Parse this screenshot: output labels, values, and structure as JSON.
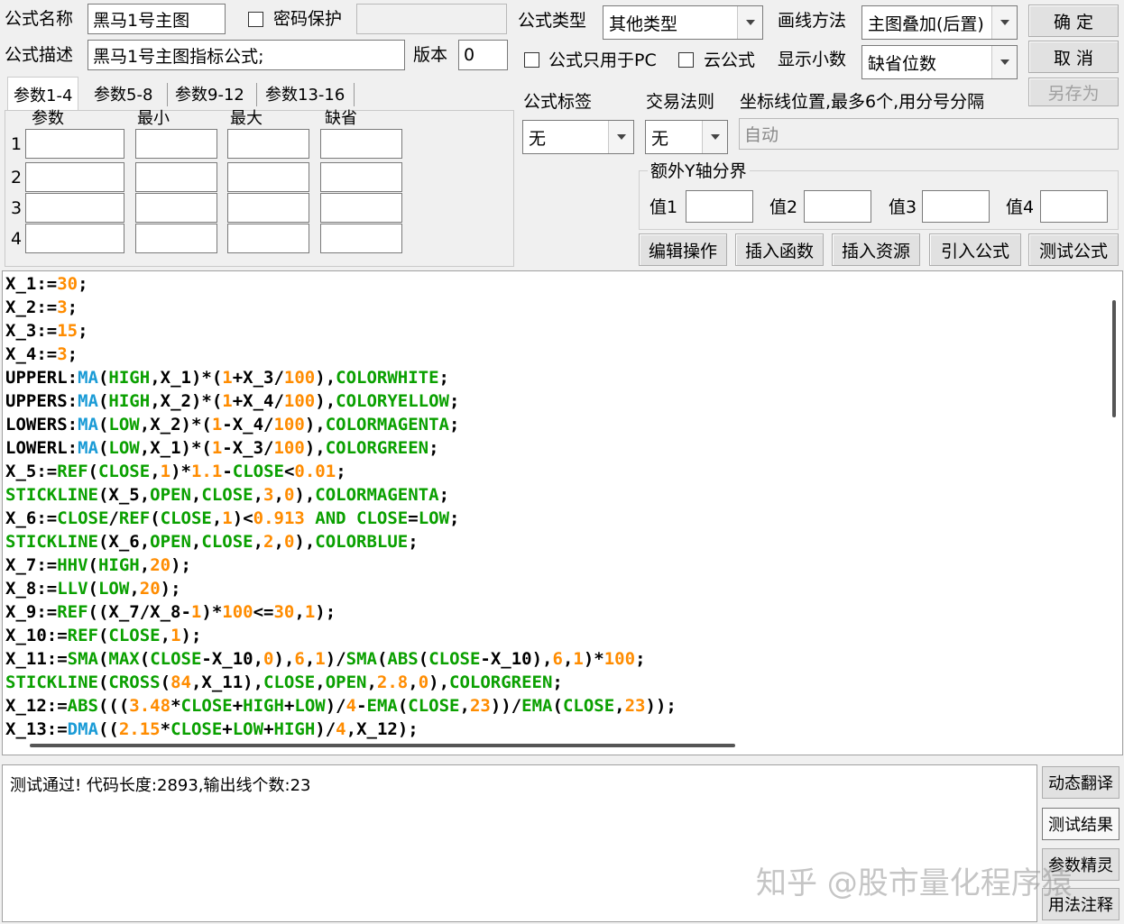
{
  "header": {
    "name_label": "公式名称",
    "name_value": "黑马1号主图",
    "password_label": "密码保护",
    "desc_label": "公式描述",
    "desc_value": "黑马1号主图指标公式;",
    "version_label": "版本",
    "version_value": "0",
    "type_label": "公式类型",
    "type_value": "其他类型",
    "draw_label": "画线方法",
    "draw_value": "主图叠加(后置)",
    "pc_only_label": "公式只用于PC",
    "cloud_label": "云公式",
    "decimal_label": "显示小数",
    "decimal_value": "缺省位数"
  },
  "buttons": {
    "ok": "确  定",
    "cancel": "取  消",
    "save_as": "另存为",
    "edit_ops": "编辑操作",
    "insert_func": "插入函数",
    "insert_res": "插入资源",
    "import_formula": "引入公式",
    "test_formula": "测试公式"
  },
  "tabs": [
    "参数1-4",
    "参数5-8",
    "参数9-12",
    "参数13-16"
  ],
  "params": {
    "headers": [
      "参数",
      "最小",
      "最大",
      "缺省"
    ],
    "rows": [
      "1",
      "2",
      "3",
      "4"
    ]
  },
  "tag": {
    "label": "公式标签",
    "value": "无"
  },
  "trade": {
    "label": "交易法则",
    "value": "无"
  },
  "coord": {
    "label": "坐标线位置,最多6个,用分号分隔",
    "value": "自动"
  },
  "yaxis": {
    "title": "额外Y轴分界",
    "labels": [
      "值1",
      "值2",
      "值3",
      "值4"
    ]
  },
  "colors": {
    "default": "#000000",
    "num": "#ff8c00",
    "func": "#0aa000",
    "cfn": "#1a9bd6"
  },
  "code_lines": [
    [
      [
        "X_1:=",
        "default"
      ],
      [
        "30",
        "num"
      ],
      [
        ";",
        "default"
      ]
    ],
    [
      [
        "X_2:=",
        "default"
      ],
      [
        "3",
        "num"
      ],
      [
        ";",
        "default"
      ]
    ],
    [
      [
        "X_3:=",
        "default"
      ],
      [
        "15",
        "num"
      ],
      [
        ";",
        "default"
      ]
    ],
    [
      [
        "X_4:=",
        "default"
      ],
      [
        "3",
        "num"
      ],
      [
        ";",
        "default"
      ]
    ],
    [
      [
        "UPPERL:",
        "default"
      ],
      [
        "MA",
        "cfn"
      ],
      [
        "(",
        "default"
      ],
      [
        "HIGH",
        "func"
      ],
      [
        ",X_1)*(",
        "default"
      ],
      [
        "1",
        "num"
      ],
      [
        "+X_3/",
        "default"
      ],
      [
        "100",
        "num"
      ],
      [
        "),",
        "default"
      ],
      [
        "COLORWHITE",
        "func"
      ],
      [
        ";",
        "default"
      ]
    ],
    [
      [
        "UPPERS:",
        "default"
      ],
      [
        "MA",
        "cfn"
      ],
      [
        "(",
        "default"
      ],
      [
        "HIGH",
        "func"
      ],
      [
        ",X_2)*(",
        "default"
      ],
      [
        "1",
        "num"
      ],
      [
        "+X_4/",
        "default"
      ],
      [
        "100",
        "num"
      ],
      [
        "),",
        "default"
      ],
      [
        "COLORYELLOW",
        "func"
      ],
      [
        ";",
        "default"
      ]
    ],
    [
      [
        "LOWERS:",
        "default"
      ],
      [
        "MA",
        "cfn"
      ],
      [
        "(",
        "default"
      ],
      [
        "LOW",
        "func"
      ],
      [
        ",X_2)*(",
        "default"
      ],
      [
        "1",
        "num"
      ],
      [
        "-X_4/",
        "default"
      ],
      [
        "100",
        "num"
      ],
      [
        "),",
        "default"
      ],
      [
        "COLORMAGENTA",
        "func"
      ],
      [
        ";",
        "default"
      ]
    ],
    [
      [
        "LOWERL:",
        "default"
      ],
      [
        "MA",
        "cfn"
      ],
      [
        "(",
        "default"
      ],
      [
        "LOW",
        "func"
      ],
      [
        ",X_1)*(",
        "default"
      ],
      [
        "1",
        "num"
      ],
      [
        "-X_3/",
        "default"
      ],
      [
        "100",
        "num"
      ],
      [
        "),",
        "default"
      ],
      [
        "COLORGREEN",
        "func"
      ],
      [
        ";",
        "default"
      ]
    ],
    [
      [
        "X_5:=",
        "default"
      ],
      [
        "REF",
        "func"
      ],
      [
        "(",
        "default"
      ],
      [
        "CLOSE",
        "func"
      ],
      [
        ",",
        "default"
      ],
      [
        "1",
        "num"
      ],
      [
        ")*",
        "default"
      ],
      [
        "1.1",
        "num"
      ],
      [
        "-",
        "default"
      ],
      [
        "CLOSE",
        "func"
      ],
      [
        "<",
        "default"
      ],
      [
        "0.01",
        "num"
      ],
      [
        ";",
        "default"
      ]
    ],
    [
      [
        "STICKLINE",
        "func"
      ],
      [
        "(X_5,",
        "default"
      ],
      [
        "OPEN",
        "func"
      ],
      [
        ",",
        "default"
      ],
      [
        "CLOSE",
        "func"
      ],
      [
        ",",
        "default"
      ],
      [
        "3",
        "num"
      ],
      [
        ",",
        "default"
      ],
      [
        "0",
        "num"
      ],
      [
        "),",
        "default"
      ],
      [
        "COLORMAGENTA",
        "func"
      ],
      [
        ";",
        "default"
      ]
    ],
    [
      [
        "X_6:=",
        "default"
      ],
      [
        "CLOSE",
        "func"
      ],
      [
        "/",
        "default"
      ],
      [
        "REF",
        "func"
      ],
      [
        "(",
        "default"
      ],
      [
        "CLOSE",
        "func"
      ],
      [
        ",",
        "default"
      ],
      [
        "1",
        "num"
      ],
      [
        ")<",
        "default"
      ],
      [
        "0.913",
        "num"
      ],
      [
        " AND ",
        "func"
      ],
      [
        "CLOSE",
        "func"
      ],
      [
        "=",
        "default"
      ],
      [
        "LOW",
        "func"
      ],
      [
        ";",
        "default"
      ]
    ],
    [
      [
        "STICKLINE",
        "func"
      ],
      [
        "(X_6,",
        "default"
      ],
      [
        "OPEN",
        "func"
      ],
      [
        ",",
        "default"
      ],
      [
        "CLOSE",
        "func"
      ],
      [
        ",",
        "default"
      ],
      [
        "2",
        "num"
      ],
      [
        ",",
        "default"
      ],
      [
        "0",
        "num"
      ],
      [
        "),",
        "default"
      ],
      [
        "COLORBLUE",
        "func"
      ],
      [
        ";",
        "default"
      ]
    ],
    [
      [
        "X_7:=",
        "default"
      ],
      [
        "HHV",
        "func"
      ],
      [
        "(",
        "default"
      ],
      [
        "HIGH",
        "func"
      ],
      [
        ",",
        "default"
      ],
      [
        "20",
        "num"
      ],
      [
        ");",
        "default"
      ]
    ],
    [
      [
        "X_8:=",
        "default"
      ],
      [
        "LLV",
        "func"
      ],
      [
        "(",
        "default"
      ],
      [
        "LOW",
        "func"
      ],
      [
        ",",
        "default"
      ],
      [
        "20",
        "num"
      ],
      [
        ");",
        "default"
      ]
    ],
    [
      [
        "X_9:=",
        "default"
      ],
      [
        "REF",
        "func"
      ],
      [
        "((X_7/X_8-",
        "default"
      ],
      [
        "1",
        "num"
      ],
      [
        ")*",
        "default"
      ],
      [
        "100",
        "num"
      ],
      [
        "<=",
        "default"
      ],
      [
        "30",
        "num"
      ],
      [
        ",",
        "default"
      ],
      [
        "1",
        "num"
      ],
      [
        ");",
        "default"
      ]
    ],
    [
      [
        "X_10:=",
        "default"
      ],
      [
        "REF",
        "func"
      ],
      [
        "(",
        "default"
      ],
      [
        "CLOSE",
        "func"
      ],
      [
        ",",
        "default"
      ],
      [
        "1",
        "num"
      ],
      [
        ");",
        "default"
      ]
    ],
    [
      [
        "X_11:=",
        "default"
      ],
      [
        "SMA",
        "func"
      ],
      [
        "(",
        "default"
      ],
      [
        "MAX",
        "func"
      ],
      [
        "(",
        "default"
      ],
      [
        "CLOSE",
        "func"
      ],
      [
        "-X_10,",
        "default"
      ],
      [
        "0",
        "num"
      ],
      [
        "),",
        "default"
      ],
      [
        "6",
        "num"
      ],
      [
        ",",
        "default"
      ],
      [
        "1",
        "num"
      ],
      [
        ")/",
        "default"
      ],
      [
        "SMA",
        "func"
      ],
      [
        "(",
        "default"
      ],
      [
        "ABS",
        "func"
      ],
      [
        "(",
        "default"
      ],
      [
        "CLOSE",
        "func"
      ],
      [
        "-X_10),",
        "default"
      ],
      [
        "6",
        "num"
      ],
      [
        ",",
        "default"
      ],
      [
        "1",
        "num"
      ],
      [
        ")*",
        "default"
      ],
      [
        "100",
        "num"
      ],
      [
        ";",
        "default"
      ]
    ],
    [
      [
        "STICKLINE",
        "func"
      ],
      [
        "(",
        "default"
      ],
      [
        "CROSS",
        "func"
      ],
      [
        "(",
        "default"
      ],
      [
        "84",
        "num"
      ],
      [
        ",X_11),",
        "default"
      ],
      [
        "CLOSE",
        "func"
      ],
      [
        ",",
        "default"
      ],
      [
        "OPEN",
        "func"
      ],
      [
        ",",
        "default"
      ],
      [
        "2.8",
        "num"
      ],
      [
        ",",
        "default"
      ],
      [
        "0",
        "num"
      ],
      [
        "),",
        "default"
      ],
      [
        "COLORGREEN",
        "func"
      ],
      [
        ";",
        "default"
      ]
    ],
    [
      [
        "X_12:=",
        "default"
      ],
      [
        "ABS",
        "func"
      ],
      [
        "(((",
        "default"
      ],
      [
        "3.48",
        "num"
      ],
      [
        "*",
        "default"
      ],
      [
        "CLOSE",
        "func"
      ],
      [
        "+",
        "default"
      ],
      [
        "HIGH",
        "func"
      ],
      [
        "+",
        "default"
      ],
      [
        "LOW",
        "func"
      ],
      [
        ")/",
        "default"
      ],
      [
        "4",
        "num"
      ],
      [
        "-",
        "default"
      ],
      [
        "EMA",
        "func"
      ],
      [
        "(",
        "default"
      ],
      [
        "CLOSE",
        "func"
      ],
      [
        ",",
        "default"
      ],
      [
        "23",
        "num"
      ],
      [
        "))/",
        "default"
      ],
      [
        "EMA",
        "func"
      ],
      [
        "(",
        "default"
      ],
      [
        "CLOSE",
        "func"
      ],
      [
        ",",
        "default"
      ],
      [
        "23",
        "num"
      ],
      [
        "));",
        "default"
      ]
    ],
    [
      [
        "X_13:=",
        "default"
      ],
      [
        "DMA",
        "cfn"
      ],
      [
        "((",
        "default"
      ],
      [
        "2.15",
        "num"
      ],
      [
        "*",
        "default"
      ],
      [
        "CLOSE",
        "func"
      ],
      [
        "+",
        "default"
      ],
      [
        "LOW",
        "func"
      ],
      [
        "+",
        "default"
      ],
      [
        "HIGH",
        "func"
      ],
      [
        ")/",
        "default"
      ],
      [
        "4",
        "num"
      ],
      [
        ",X_12);",
        "default"
      ]
    ]
  ],
  "output": {
    "message": "测试通过! 代码长度:2893,输出线个数:23"
  },
  "side_buttons": [
    "动态翻译",
    "测试结果",
    "参数精灵",
    "用法注释"
  ],
  "watermark": "知乎 @股市量化程序猿"
}
